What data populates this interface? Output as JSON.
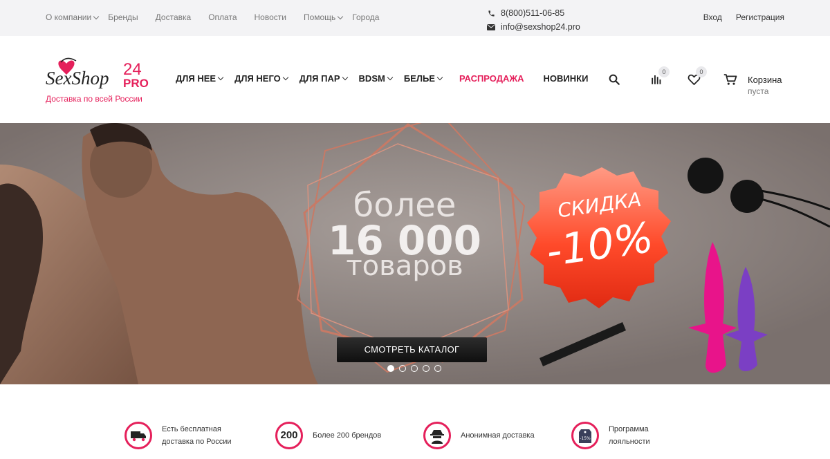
{
  "topbar": {
    "nav": [
      {
        "label": "О компании",
        "dropdown": true
      },
      {
        "label": "Бренды",
        "dropdown": false
      },
      {
        "label": "Доставка",
        "dropdown": false
      },
      {
        "label": "Оплата",
        "dropdown": false
      },
      {
        "label": "Новости",
        "dropdown": false
      },
      {
        "label": "Помощь",
        "dropdown": true
      },
      {
        "label": "Города",
        "dropdown": false
      }
    ],
    "phone": "8(800)511-06-85",
    "email": "info@sexshop24.pro",
    "login": "Вход",
    "register": "Регистрация"
  },
  "header": {
    "logo": {
      "text": "SexShop",
      "num": "24",
      "pro": "PRO",
      "slogan": "Доставка по всей России"
    },
    "nav": [
      {
        "label": "ДЛЯ НЕЕ",
        "dropdown": true
      },
      {
        "label": "ДЛЯ НЕГО",
        "dropdown": true
      },
      {
        "label": "ДЛЯ ПАР",
        "dropdown": true
      },
      {
        "label": "BDSM",
        "dropdown": true
      },
      {
        "label": "БЕЛЬЕ",
        "dropdown": true
      },
      {
        "label": "РАСПРОДАЖА",
        "dropdown": false
      },
      {
        "label": "НОВИНКИ",
        "dropdown": false
      }
    ],
    "compare_count": "0",
    "favorites_count": "0",
    "cart_title": "Корзина",
    "cart_status": "пуста"
  },
  "banner": {
    "line1": "более",
    "line2": "16 000",
    "line3": "товаров",
    "discount_label": "СКИДКА",
    "discount_value": "-10%",
    "button": "СМОТРЕТЬ КАТАЛОГ",
    "slides": 5,
    "active_slide": 1
  },
  "features": [
    {
      "line1": "Есть бесплатная",
      "line2": "доставка по России",
      "icon": "truck-icon"
    },
    {
      "line1": "Более 200 брендов",
      "line2": "",
      "icon": "200",
      "badge": "200"
    },
    {
      "line1": "Анонимная доставка",
      "line2": "",
      "icon": "spy-icon"
    },
    {
      "line1": "Программа",
      "line2": "лояльности",
      "icon": "tag-icon",
      "badge": "-15%"
    }
  ],
  "colors": {
    "accent": "#e5205b",
    "topbar": "#f3f3f5"
  }
}
